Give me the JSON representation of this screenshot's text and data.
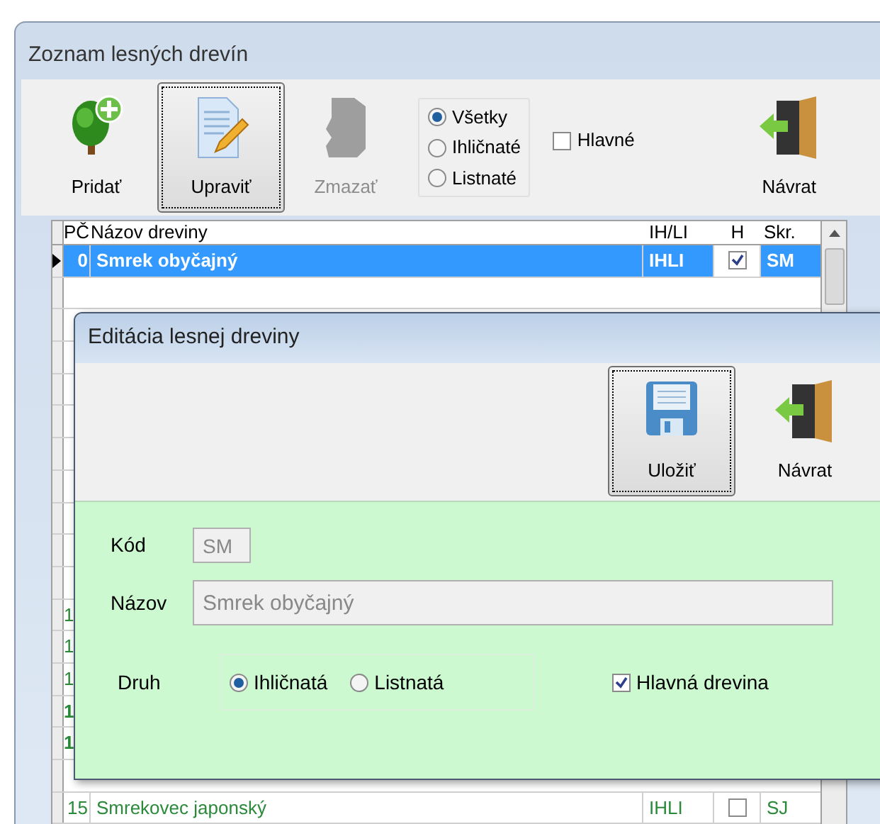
{
  "window": {
    "title": "Zoznam lesných drevín"
  },
  "toolbar": {
    "buttons": [
      {
        "label": "Pridať",
        "kind": "add",
        "disabled": false,
        "focused": false
      },
      {
        "label": "Upraviť",
        "kind": "edit",
        "disabled": false,
        "focused": true
      },
      {
        "label": "Zmazať",
        "kind": "delete",
        "disabled": true,
        "focused": false
      }
    ],
    "filter": [
      {
        "label": "Všetky",
        "selected": true
      },
      {
        "label": "Ihličnaté",
        "selected": false
      },
      {
        "label": "Listnaté",
        "selected": false
      }
    ],
    "main_only": {
      "label": "Hlavné",
      "checked": false
    },
    "back": {
      "label": "Návrat",
      "kind": "back",
      "disabled": false,
      "focused": false
    }
  },
  "table": {
    "columns": [
      "PČ",
      "Názov dreviny",
      "IH/LI",
      "H",
      "Skr."
    ],
    "rows": [
      {
        "kind": "full",
        "pc": "0",
        "name": "Smrek obyčajný",
        "type": "IHLI",
        "main": true,
        "code": "SM",
        "selected": true
      },
      {
        "kind": "partial",
        "pc": "1",
        "bold": false
      },
      {
        "kind": "partial",
        "pc": "1",
        "bold": false
      },
      {
        "kind": "partial",
        "pc": "1",
        "bold": false
      },
      {
        "kind": "partial",
        "pc": "1",
        "bold": true
      },
      {
        "kind": "partial",
        "pc": "1",
        "bold": true
      },
      {
        "kind": "full",
        "pc": "15",
        "name": "Smrekovec japonský",
        "type": "IHLI",
        "main": false,
        "code": "SJ",
        "selected": false
      }
    ]
  },
  "dialog": {
    "title": "Editácia lesnej dreviny",
    "buttons": [
      {
        "label": "Uložiť",
        "kind": "save",
        "disabled": false,
        "focused": true
      },
      {
        "label": "Návrat",
        "kind": "back",
        "disabled": false,
        "focused": false
      }
    ],
    "code": {
      "label": "Kód",
      "value": "SM"
    },
    "name": {
      "label": "Názov",
      "value": "Smrek obyčajný"
    },
    "kind": {
      "label": "Druh",
      "options": [
        {
          "label": "Ihličnatá",
          "selected": true
        },
        {
          "label": "Listnatá",
          "selected": false
        }
      ]
    },
    "main": {
      "label": "Hlavná drevina",
      "checked": true
    }
  }
}
